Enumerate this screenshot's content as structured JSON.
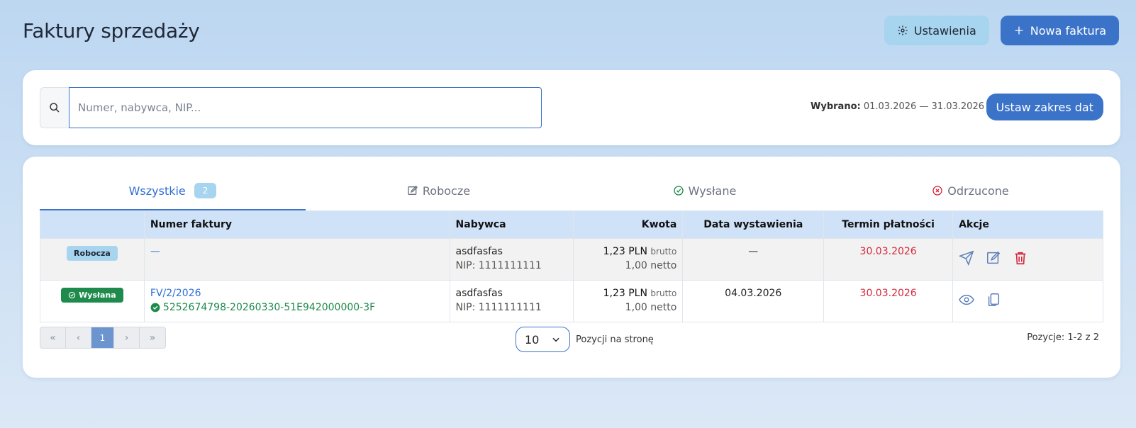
{
  "header": {
    "title": "Faktury sprzedaży",
    "settings_label": "Ustawienia",
    "new_invoice_label": "Nowa faktura"
  },
  "filter": {
    "search_placeholder": "Numer, nabywca, NIP...",
    "search_value": "",
    "selected_prefix": "Wybrano:",
    "selected_range": "01.03.2026 — 31.03.2026",
    "set_range_label": "Ustaw zakres dat"
  },
  "tabs": [
    {
      "label": "Wszystkie",
      "badge": "2"
    },
    {
      "label": "Robocze"
    },
    {
      "label": "Wysłane"
    },
    {
      "label": "Odrzucone"
    }
  ],
  "table": {
    "columns": [
      "",
      "Numer faktury",
      "Nabywca",
      "Kwota",
      "Data wystawienia",
      "Termin płatności",
      "Akcje"
    ],
    "rows": [
      {
        "status": "Robocza",
        "number": "—",
        "ksef": "",
        "buyer": "asdfasfas",
        "nip": "NIP: 1111111111",
        "gross": "1,23 PLN",
        "gross_suffix": "brutto",
        "net": "1,00 netto",
        "issue_date": "—",
        "due_date": "30.03.2026"
      },
      {
        "status": "Wysłana",
        "number": "FV/2/2026",
        "ksef": "5252674798-20260330-51E942000000-3F",
        "buyer": "asdfasfas",
        "nip": "NIP: 1111111111",
        "gross": "1,23 PLN",
        "gross_suffix": "brutto",
        "net": "1,00 netto",
        "issue_date": "04.03.2026",
        "due_date": "30.03.2026"
      }
    ]
  },
  "pagination": {
    "current_page": "1",
    "per_page": "10",
    "per_page_label": "Pozycji na stronę",
    "positions": "Pozycje: 1-2 z 2"
  },
  "colors": {
    "primary": "#3b73c9",
    "settings_bg": "#a7d4ee",
    "sent_green": "#1e8a4c",
    "due_red": "#d6293e"
  }
}
